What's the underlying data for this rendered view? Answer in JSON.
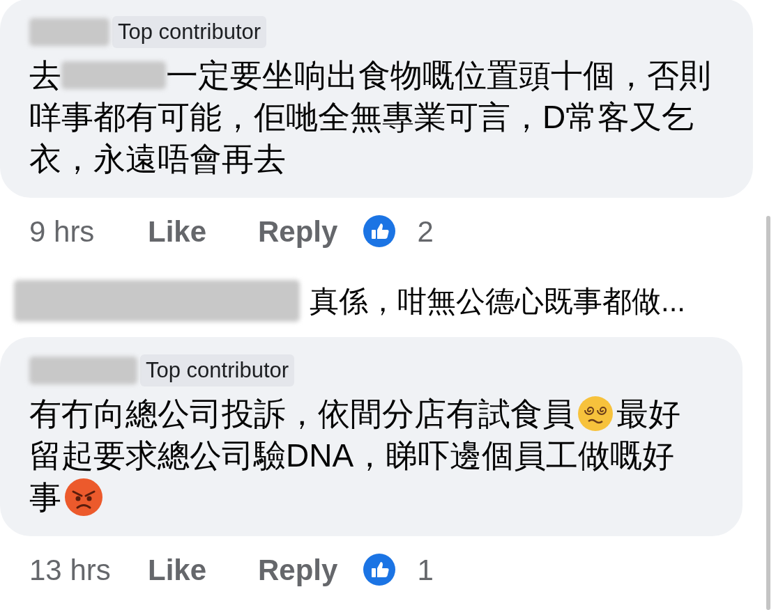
{
  "comments": [
    {
      "badge": "Top contributor",
      "lines": [
        [
          {
            "kind": "text",
            "text": "去"
          },
          {
            "kind": "blur"
          },
          {
            "kind": "text",
            "text": "一定要坐响出食物嘅位置頭十個，否則"
          }
        ],
        [
          {
            "kind": "text",
            "text": "咩事都有可能，佢哋全無專業可言，D常客又乞"
          }
        ],
        [
          {
            "kind": "text",
            "text": "衣，永遠唔會再去"
          }
        ]
      ],
      "time": "9 hrs",
      "like": "Like",
      "reply": "Reply",
      "reactions": "2"
    },
    {
      "badge": "Top contributor",
      "lines": [
        [
          {
            "kind": "text",
            "text": "有冇向總公司投訴，依間分店有試食員"
          },
          {
            "kind": "dizzy"
          },
          {
            "kind": "text",
            "text": "最好"
          }
        ],
        [
          {
            "kind": "text",
            "text": "留起要求總公司驗DNA，睇吓邊個員工做嘅好"
          }
        ],
        [
          {
            "kind": "text",
            "text": "事"
          },
          {
            "kind": "angry"
          }
        ]
      ],
      "time": "13 hrs",
      "like": "Like",
      "reply": "Reply",
      "reactions": "1"
    }
  ],
  "reply_preview": {
    "text": "真係，咁無公德心既事都做..."
  }
}
